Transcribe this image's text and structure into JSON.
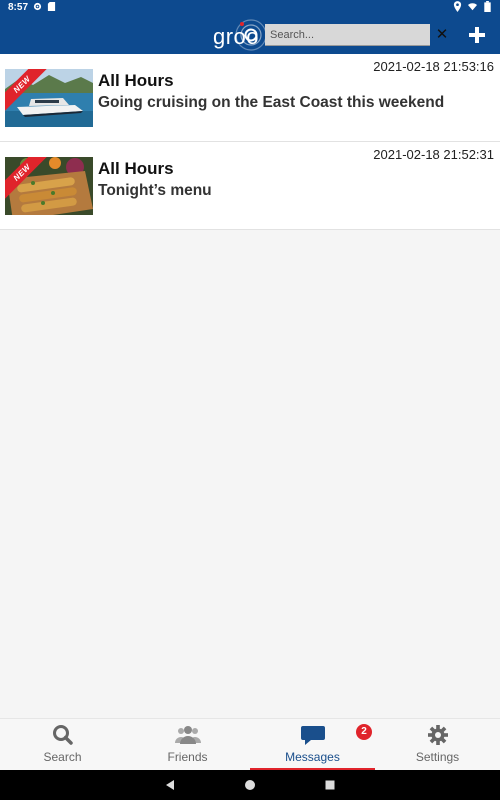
{
  "status_bar": {
    "time": "8:57"
  },
  "app_bar": {
    "logo_text": "groo",
    "search": {
      "placeholder": "Search...",
      "value": ""
    },
    "clear_icon": "close-icon",
    "add_icon": "plus-icon"
  },
  "messages": [
    {
      "ribbon": "NEW",
      "title": "All Hours",
      "body": "Going cruising on the East Coast this weekend",
      "timestamp": "2021-02-18 21:53:16"
    },
    {
      "ribbon": "NEW",
      "title": "All Hours",
      "body": "Tonight’s menu",
      "timestamp": "2021-02-18 21:52:31"
    }
  ],
  "bottom_nav": {
    "items": [
      {
        "label": "Search",
        "icon": "search-icon",
        "active": false
      },
      {
        "label": "Friends",
        "icon": "friends-icon",
        "active": false
      },
      {
        "label": "Messages",
        "icon": "messages-icon",
        "active": true,
        "badge": "2"
      },
      {
        "label": "Settings",
        "icon": "gear-icon",
        "active": false
      }
    ]
  },
  "colors": {
    "brand": "#0d4a8f",
    "accent": "#e0242b",
    "active_nav": "#1a4f8c"
  }
}
